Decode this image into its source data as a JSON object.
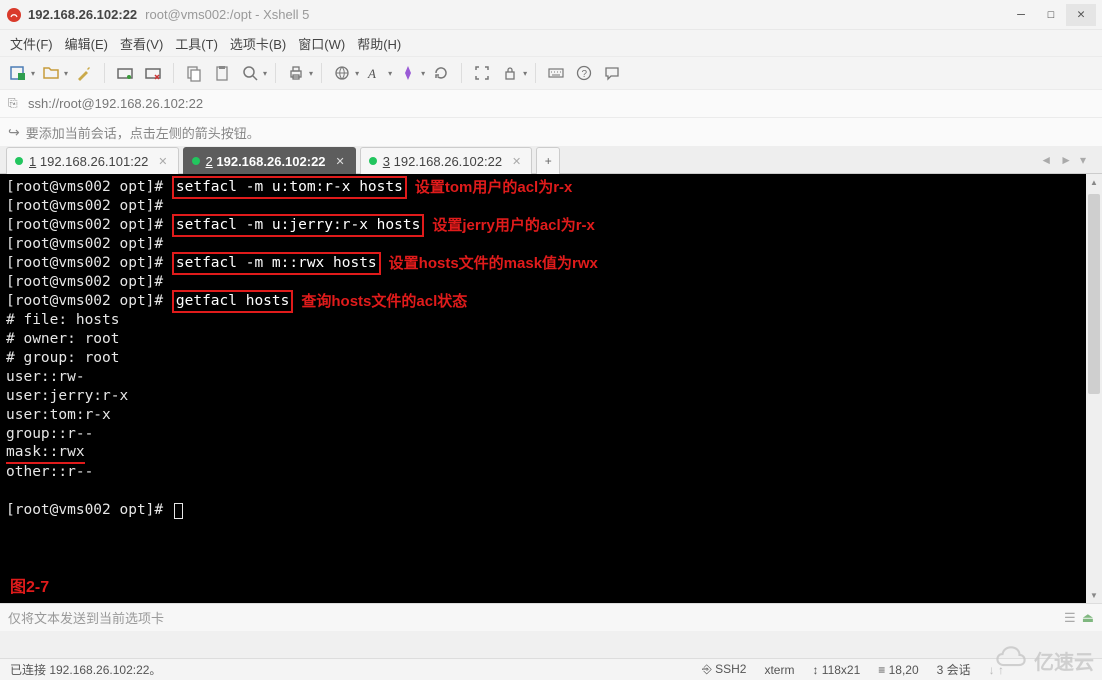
{
  "title": {
    "host": "192.168.26.102:22",
    "context": "root@vms002:/opt - Xshell 5"
  },
  "menu": {
    "file": "文件(F)",
    "edit": "编辑(E)",
    "view": "查看(V)",
    "tools": "工具(T)",
    "tabs": "选项卡(B)",
    "window": "窗口(W)",
    "help": "帮助(H)"
  },
  "addrbar": {
    "url": "ssh://root@192.168.26.102:22"
  },
  "hintbar": {
    "text": "要添加当前会话，点击左侧的箭头按钮。"
  },
  "tabs": {
    "items": [
      {
        "num": "1",
        "label": "192.168.26.101:22"
      },
      {
        "num": "2",
        "label": "192.168.26.102:22"
      },
      {
        "num": "3",
        "label": "192.168.26.102:22"
      }
    ],
    "add": "+"
  },
  "terminal": {
    "prompt": "[root@vms002 opt]# ",
    "lines": [
      {
        "cmd": "setfacl -m u:tom:r-x hosts",
        "annot": "设置tom用户的acl为r-x"
      },
      {
        "cmd": ""
      },
      {
        "cmd": "setfacl -m u:jerry:r-x hosts",
        "annot": "设置jerry用户的acl为r-x"
      },
      {
        "cmd": ""
      },
      {
        "cmd": "setfacl -m m::rwx hosts",
        "annot": "设置hosts文件的mask值为rwx"
      },
      {
        "cmd": ""
      },
      {
        "cmd": "getfacl hosts",
        "annot": "查询hosts文件的acl状态"
      }
    ],
    "output": [
      "# file: hosts",
      "# owner: root",
      "# group: root",
      "user::rw-",
      "user:jerry:r-x",
      "user:tom:r-x",
      "group::r--",
      "mask::rwx",
      "other::r--"
    ],
    "figlabel": "图2-7"
  },
  "sendbar": {
    "placeholder": "仅将文本发送到当前选项卡"
  },
  "status": {
    "conn": "已连接 192.168.26.102:22。",
    "proto": "SSH2",
    "term": "xterm",
    "size": "118x21",
    "pos": "18,20",
    "sessions": "3 会话"
  },
  "watermark": {
    "text": "亿速云"
  },
  "icons": {
    "newtab": "new-tab-icon",
    "folder": "folder-icon",
    "wand": "properties-icon",
    "connect": "connect-icon",
    "disconnect": "disconnect-icon",
    "copy": "copy-icon",
    "paste": "paste-icon",
    "search": "search-icon",
    "print": "print-icon",
    "globe": "globe-icon",
    "font": "font-icon",
    "pin": "color-scheme-icon",
    "refresh": "refresh-icon",
    "fullscreen": "fullscreen-icon",
    "lock": "lock-icon",
    "keyboard": "keyboard-icon",
    "help": "help-icon",
    "chat": "chat-icon"
  }
}
